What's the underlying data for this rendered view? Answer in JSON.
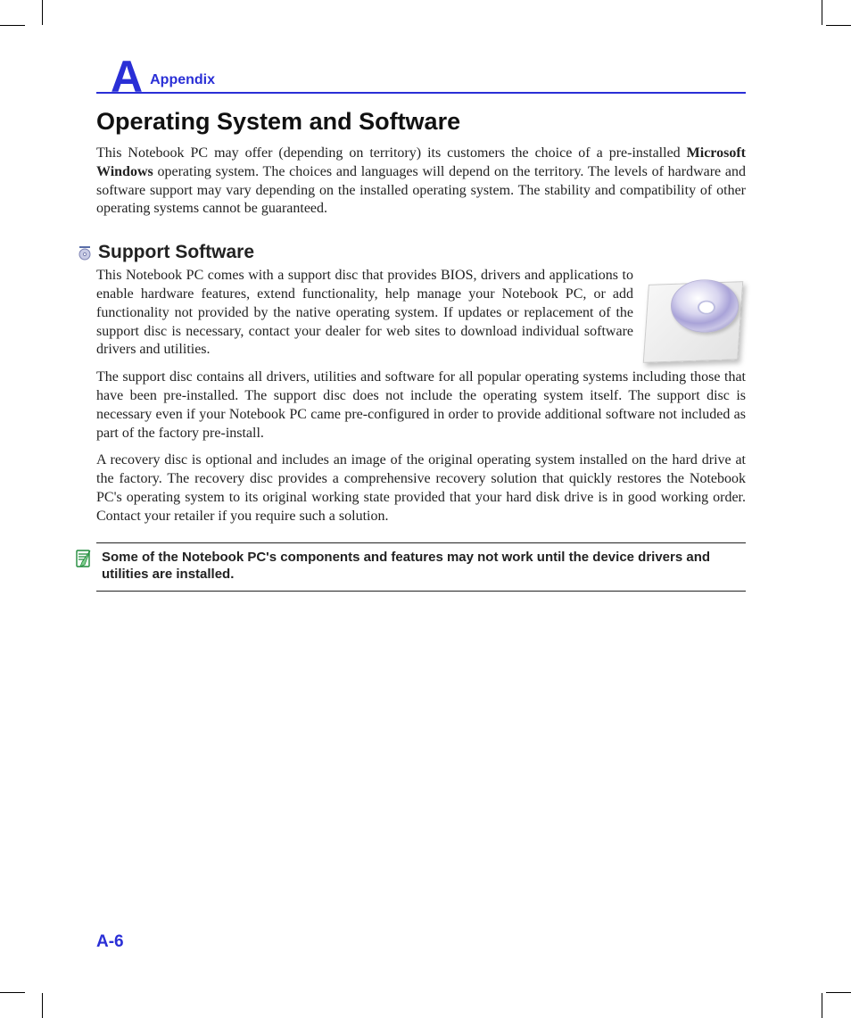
{
  "header": {
    "letter": "A",
    "label": "Appendix"
  },
  "title": "Operating System and Software",
  "intro": {
    "pre": "This Notebook PC may offer (depending on territory) its customers the choice of a pre-installed ",
    "os": "Microsoft Windows",
    "post": " operating system. The choices and languages will depend on the territory. The levels of hardware and software support may vary depending on the installed operating system. The stability and compatibility of other operating systems cannot be guaranteed."
  },
  "support": {
    "heading": "Support Software",
    "p1": "This Notebook PC comes with a support disc that provides BIOS, drivers and applications to enable hardware features, extend functionality, help manage your Notebook PC, or add functionality not provided by the native operating system. If updates or replacement of the support disc is necessary, contact your dealer for web sites to download individual software drivers and utilities.",
    "p2": "The support disc contains all drivers, utilities and software for all popular operating systems including those that have been pre-installed. The support disc does not include the operating system itself. The support disc is necessary even if your Notebook PC came pre-configured in order to provide additional software not included as part of the factory pre-install.",
    "p3": "A recovery disc is optional and includes an image of the original operating system installed on the hard drive at the factory. The recovery disc provides a comprehensive recovery solution that quickly restores the Notebook PC's operating system to its original working state provided that your hard disk drive is in good working order. Contact your retailer if you require such a solution."
  },
  "note": "Some of the Notebook PC's components and features may not work until the device drivers and utilities are installed.",
  "page_number": "A-6"
}
